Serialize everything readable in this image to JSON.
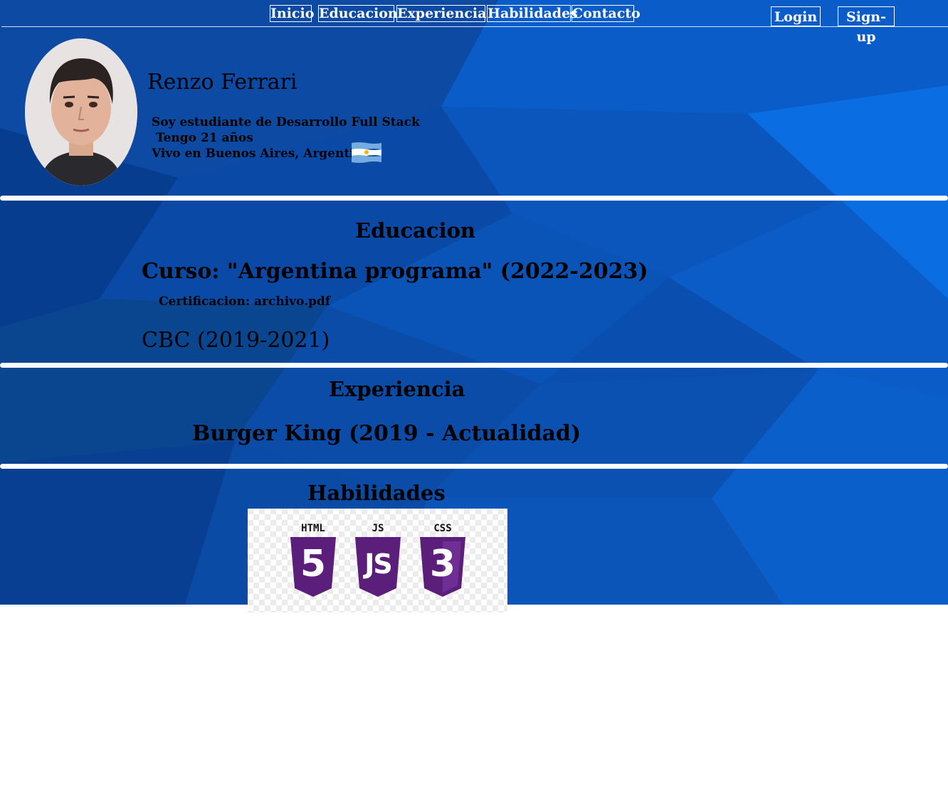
{
  "nav": {
    "links": [
      "Inicio",
      "Educacion",
      "Experiencia",
      "Habilidades",
      "Contacto"
    ],
    "login": "Login",
    "signup": "Sign-up"
  },
  "profile": {
    "name": "Renzo Ferrari",
    "bio": [
      "Soy estudiante de Desarrollo Full Stack",
      " Tengo 21 años",
      "Vivo en Buenos Aires, Argentina"
    ],
    "flag_icon": "argentina-flag-icon"
  },
  "education": {
    "title": "Educacion",
    "items": [
      {
        "title": "Curso: \"Argentina programa\" (2022-2023)",
        "certificate": "Certificacion: archivo.pdf"
      },
      {
        "title": "CBC (2019-2021)"
      }
    ]
  },
  "experience": {
    "title": "Experiencia",
    "items": [
      "Burger King (2019 - Actualidad)"
    ]
  },
  "skills": {
    "title": "Habilidades",
    "badges": [
      "HTML",
      "JS",
      "CSS"
    ],
    "badge_digits": [
      "5",
      "JS",
      "3"
    ],
    "badge_color": "#5b1e7a"
  },
  "colors": {
    "background": "#0a4fb0",
    "page": "#ffffff"
  }
}
